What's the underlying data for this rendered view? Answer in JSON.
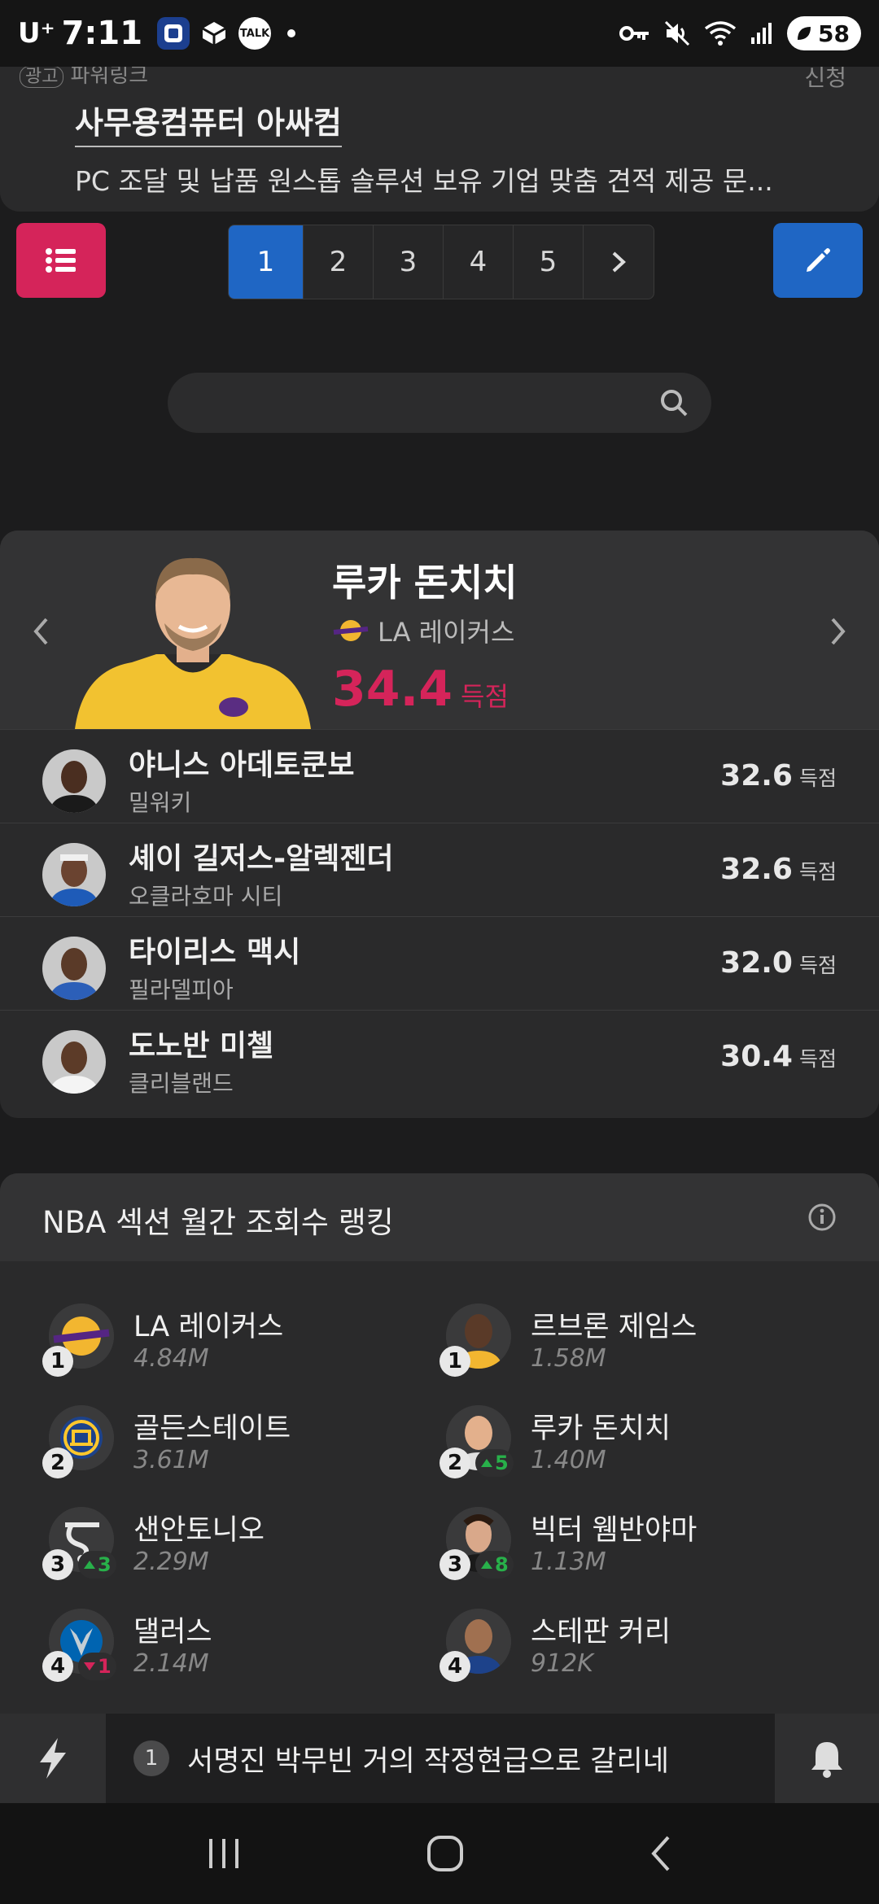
{
  "status_bar": {
    "carrier": "U⁺",
    "time": "7:11",
    "apps": [
      "KB",
      "cube",
      "TALK"
    ],
    "battery": "58"
  },
  "ad": {
    "badge": "광고",
    "source": "파워링크",
    "apply": "신청",
    "title": "사무용컴퓨터 아싸컴",
    "description": "PC 조달 및 납품 원스톱 솔루션 보유 기업 맞춤 견적 제공 문..."
  },
  "toolbar": {
    "menu_icon": "list-icon",
    "edit_icon": "pencil-icon",
    "pages": [
      "1",
      "2",
      "3",
      "4",
      "5"
    ],
    "active_page": "1",
    "next": "›"
  },
  "search": {
    "placeholder": ""
  },
  "leaders": {
    "stat_unit": "득점",
    "hero": {
      "name": "루카 돈치치",
      "team": "LA 레이커스",
      "value": "34.4",
      "accent": "#d5245a"
    },
    "rows": [
      {
        "name": "야니스 아데토쿤보",
        "team": "밀워키",
        "value": "32.6"
      },
      {
        "name": "셰이 길저스-알렉젠더",
        "team": "오클라호마 시티",
        "value": "32.6"
      },
      {
        "name": "타이리스 맥시",
        "team": "필라델피아",
        "value": "32.0"
      },
      {
        "name": "도노반 미첼",
        "team": "클리블랜드",
        "value": "30.4"
      }
    ]
  },
  "ranking": {
    "title": "NBA 섹션 월간 조회수 랭킹",
    "teams": [
      {
        "rank": "1",
        "name": "LA 레이커스",
        "views": "4.84M",
        "change": ""
      },
      {
        "rank": "2",
        "name": "골든스테이트",
        "views": "3.61M",
        "change": ""
      },
      {
        "rank": "3",
        "name": "샌안토니오",
        "views": "2.29M",
        "change": "3",
        "dir": "up"
      },
      {
        "rank": "4",
        "name": "댈러스",
        "views": "2.14M",
        "change": "1",
        "dir": "down"
      }
    ],
    "players": [
      {
        "rank": "1",
        "name": "르브론 제임스",
        "views": "1.58M",
        "change": ""
      },
      {
        "rank": "2",
        "name": "루카 돈치치",
        "views": "1.40M",
        "change": "5",
        "dir": "up"
      },
      {
        "rank": "3",
        "name": "빅터 웸반야마",
        "views": "1.13M",
        "change": "8",
        "dir": "up"
      },
      {
        "rank": "4",
        "name": "스테판 커리",
        "views": "912K",
        "change": ""
      }
    ]
  },
  "ticker": {
    "number": "1",
    "text": "서명진 박무빈 거의 작정현급으로 갈리네"
  },
  "colors": {
    "accent_pink": "#d5245a",
    "accent_blue": "#1f66c4",
    "up": "#28b04a"
  }
}
